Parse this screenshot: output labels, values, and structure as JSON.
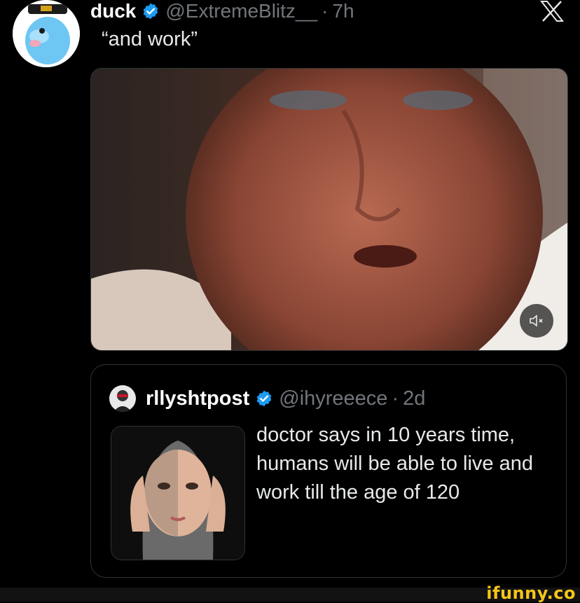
{
  "post": {
    "author": {
      "name": "duck",
      "handle": "@ExtremeBlitz__",
      "separator": "·",
      "time": "7h"
    },
    "text": "“and work”",
    "media": {
      "icon": "mute-icon"
    }
  },
  "quoted": {
    "author": {
      "name": "rllyshtpost",
      "handle": "@ihyreeece",
      "separator": "·",
      "time": "2d"
    },
    "text": "doctor says in 10 years time, humans will be able to live and work till the age of 120"
  },
  "brand": {
    "logo": "x-logo-icon"
  },
  "watermark": {
    "text": "ifunny.co"
  },
  "colors": {
    "verified": "#1d9bf0",
    "text": "#e7e9ea",
    "muted": "#71767b",
    "background": "#000000",
    "watermark": "#f5c518"
  }
}
